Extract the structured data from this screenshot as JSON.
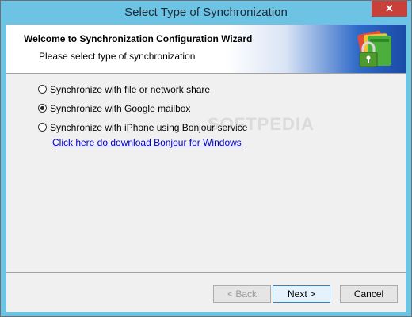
{
  "window": {
    "title": "Select Type of Synchronization",
    "close_label": "✕"
  },
  "banner": {
    "title": "Welcome to Synchronization Configuration Wizard",
    "subtitle": "Please select type of synchronization"
  },
  "options": [
    {
      "label": "Synchronize with file or network share",
      "selected": false
    },
    {
      "label": "Synchronize with Google mailbox",
      "selected": true
    },
    {
      "label": "Synchronize with iPhone using Bonjour service",
      "selected": false
    }
  ],
  "bonjour_link": "Click here do download Bonjour for Windows",
  "watermark": "SOFTPEDIA",
  "buttons": {
    "back": "< Back",
    "next": "Next >",
    "cancel": "Cancel"
  }
}
